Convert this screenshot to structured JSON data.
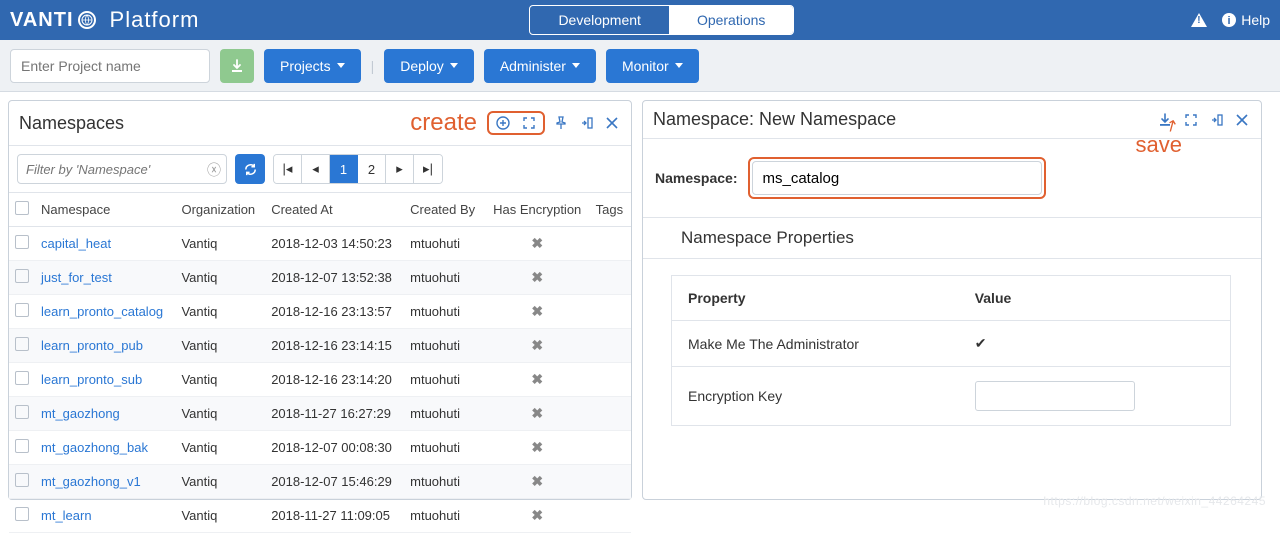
{
  "header": {
    "brand": "VANTI",
    "brand_suffix": "Platform",
    "tabs": [
      {
        "label": "Development",
        "active": false
      },
      {
        "label": "Operations",
        "active": true
      }
    ],
    "help_label": "Help"
  },
  "toolbar": {
    "project_placeholder": "Enter Project name",
    "buttons": {
      "projects": "Projects",
      "deploy": "Deploy",
      "administer": "Administer",
      "monitor": "Monitor"
    }
  },
  "annotations": {
    "create": "create",
    "save": "save"
  },
  "left_panel": {
    "title": "Namespaces",
    "filter_placeholder": "Filter by 'Namespace'",
    "pages": [
      "1",
      "2"
    ],
    "active_page": "1",
    "columns": {
      "namespace": "Namespace",
      "organization": "Organization",
      "created_at": "Created At",
      "created_by": "Created By",
      "has_encryption": "Has Encryption",
      "tags": "Tags"
    },
    "rows": [
      {
        "ns": "capital_heat",
        "org": "Vantiq",
        "created": "2018-12-03 14:50:23",
        "by": "mtuohuti"
      },
      {
        "ns": "just_for_test",
        "org": "Vantiq",
        "created": "2018-12-07 13:52:38",
        "by": "mtuohuti"
      },
      {
        "ns": "learn_pronto_catalog",
        "org": "Vantiq",
        "created": "2018-12-16 23:13:57",
        "by": "mtuohuti"
      },
      {
        "ns": "learn_pronto_pub",
        "org": "Vantiq",
        "created": "2018-12-16 23:14:15",
        "by": "mtuohuti"
      },
      {
        "ns": "learn_pronto_sub",
        "org": "Vantiq",
        "created": "2018-12-16 23:14:20",
        "by": "mtuohuti"
      },
      {
        "ns": "mt_gaozhong",
        "org": "Vantiq",
        "created": "2018-11-27 16:27:29",
        "by": "mtuohuti"
      },
      {
        "ns": "mt_gaozhong_bak",
        "org": "Vantiq",
        "created": "2018-12-07 00:08:30",
        "by": "mtuohuti"
      },
      {
        "ns": "mt_gaozhong_v1",
        "org": "Vantiq",
        "created": "2018-12-07 15:46:29",
        "by": "mtuohuti"
      },
      {
        "ns": "mt_learn",
        "org": "Vantiq",
        "created": "2018-11-27 11:09:05",
        "by": "mtuohuti"
      }
    ]
  },
  "right_panel": {
    "title": "Namespace: New Namespace",
    "field_label": "Namespace:",
    "field_value": "ms_catalog",
    "section_title": "Namespace Properties",
    "prop_header_name": "Property",
    "prop_header_value": "Value",
    "props": [
      {
        "name": "Make Me The Administrator",
        "checked": true
      },
      {
        "name": "Encryption Key",
        "checked": false
      }
    ]
  },
  "watermark": "https://blog.csdn.net/weixin_44264245"
}
